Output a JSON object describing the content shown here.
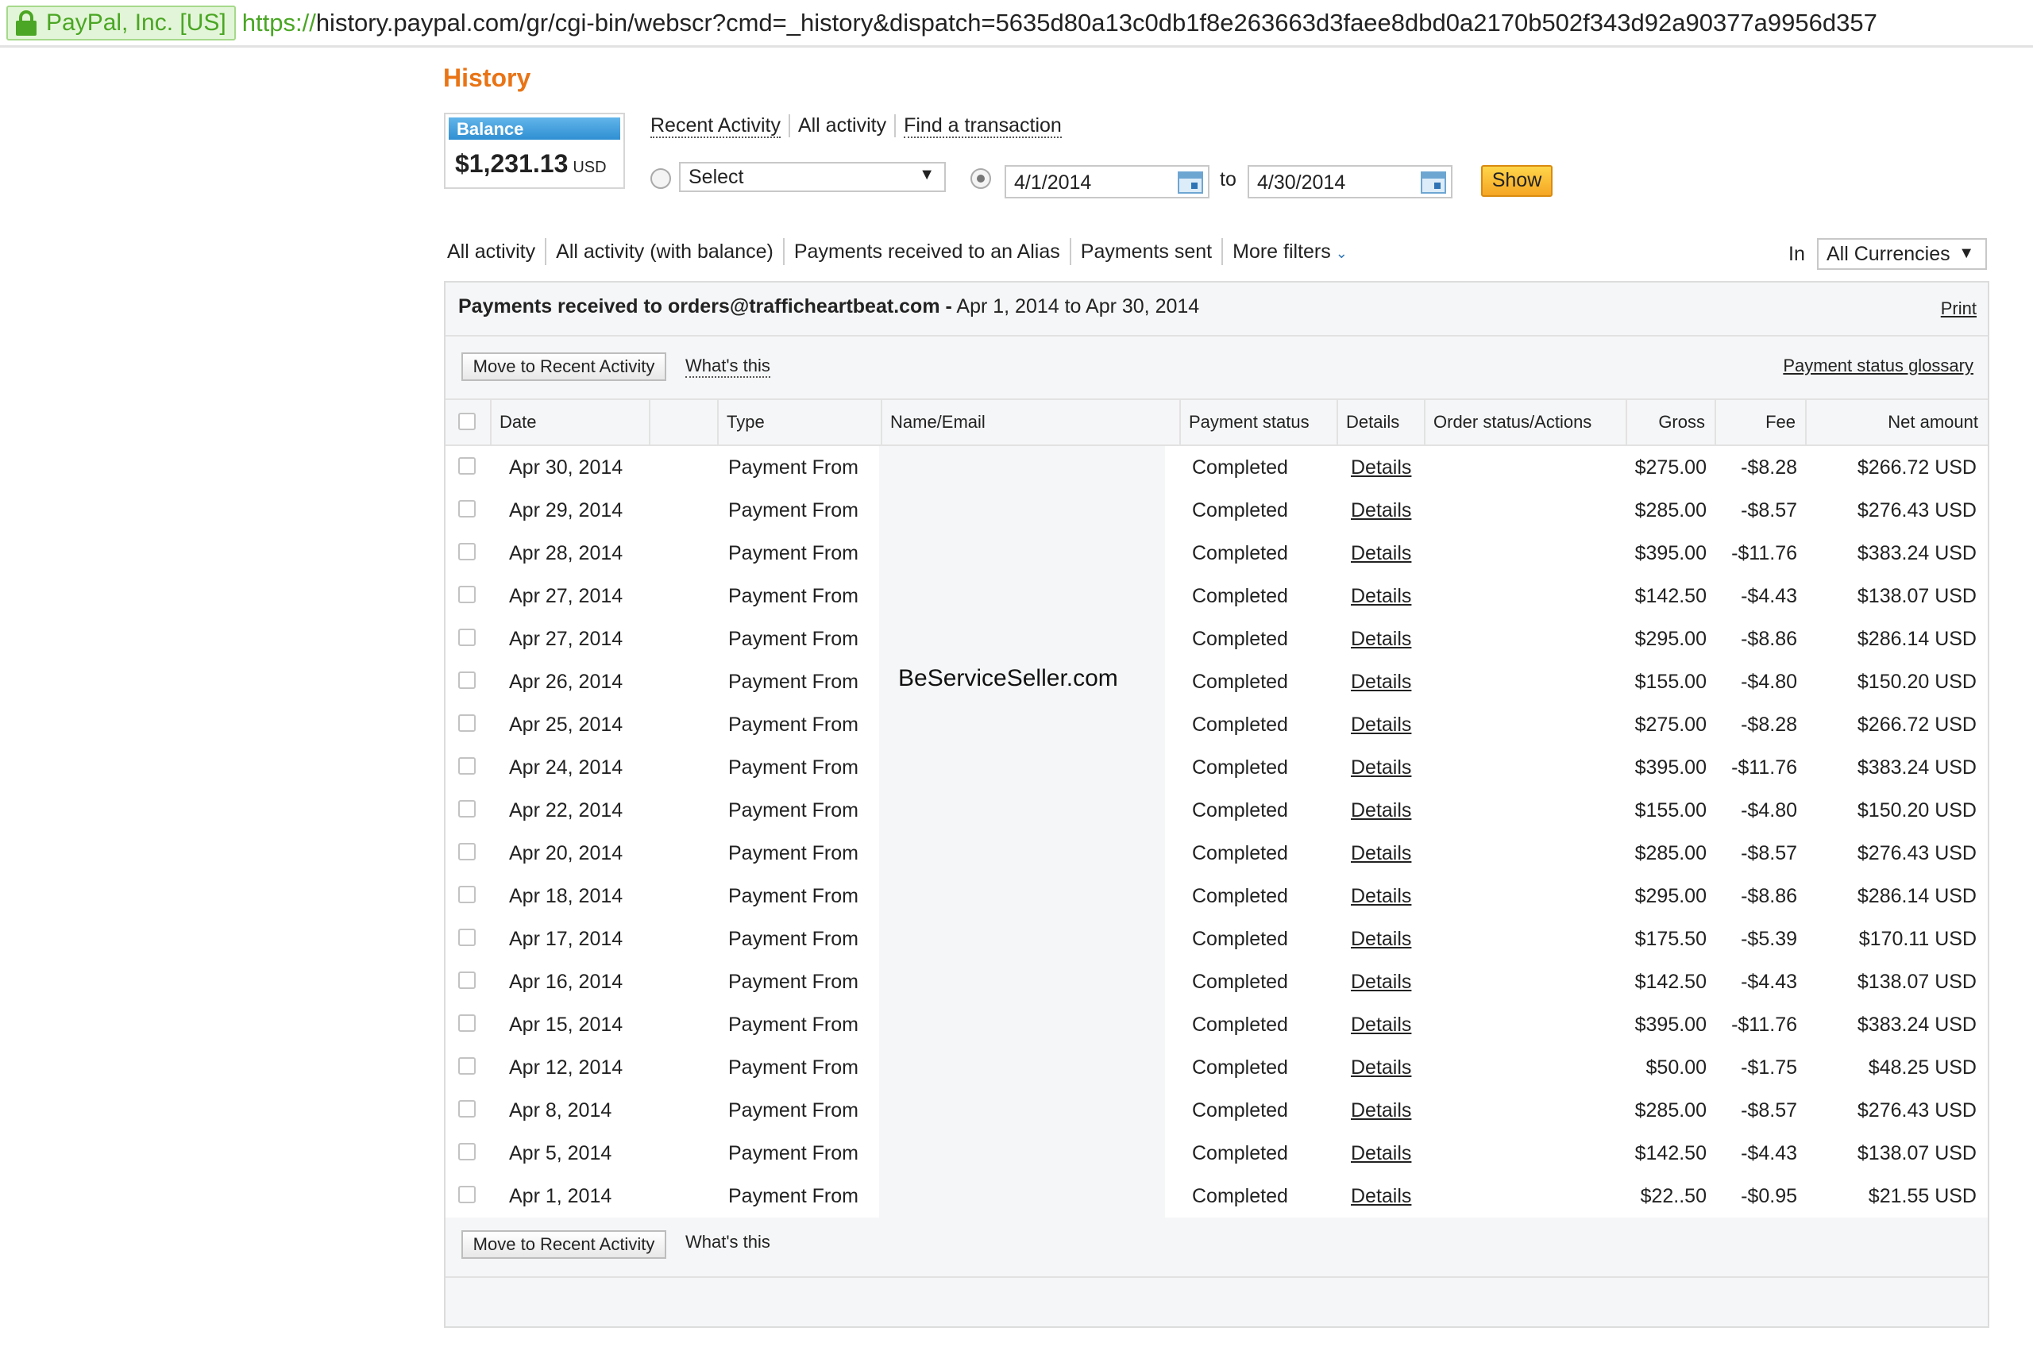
{
  "browser": {
    "ev_label": "PayPal, Inc. [US]",
    "url_scheme": "https://",
    "url_rest": "history.paypal.com/gr/cgi-bin/webscr?cmd=_history&dispatch=5635d80a13c0db1f8e263663d3faee8dbd0a2170b502f343d92a90377a9956d357"
  },
  "page": {
    "title": "History"
  },
  "balance": {
    "label": "Balance",
    "amount": "$1,231.13",
    "currency": "USD"
  },
  "top_tabs": [
    "Recent Activity",
    "All activity",
    "Find a transaction"
  ],
  "filters": {
    "select_label": "Select",
    "date_from": "4/1/2014",
    "to_label": "to",
    "date_to": "4/30/2014",
    "show_label": "Show"
  },
  "sub_tabs": [
    "All activity",
    "All activity (with balance)",
    "Payments received to an Alias",
    "Payments sent",
    "More filters"
  ],
  "currency": {
    "in_label": "In",
    "selected": "All Currencies"
  },
  "panel": {
    "title_bold": "Payments received to orders@trafficheartbeat.com -",
    "title_range": "Apr 1, 2014 to Apr 30, 2014",
    "print_label": "Print",
    "move_label": "Move to Recent Activity",
    "whats_this": "What's this",
    "glossary_label": "Payment status glossary"
  },
  "table": {
    "headers": [
      "Date",
      "Type",
      "Name/Email",
      "Payment status",
      "Details",
      "Order status/Actions",
      "Gross",
      "Fee",
      "Net amount"
    ],
    "rows": [
      {
        "date": "Apr 30, 2014",
        "type": "Payment From",
        "name": "",
        "status": "Completed",
        "details": "Details",
        "gross": "$275.00",
        "fee": "-$8.28",
        "net": "$266.72 USD"
      },
      {
        "date": "Apr 29, 2014",
        "type": "Payment From",
        "name": "",
        "status": "Completed",
        "details": "Details",
        "gross": "$285.00",
        "fee": "-$8.57",
        "net": "$276.43 USD"
      },
      {
        "date": "Apr 28, 2014",
        "type": "Payment From",
        "name": "",
        "status": "Completed",
        "details": "Details",
        "gross": "$395.00",
        "fee": "-$11.76",
        "net": "$383.24 USD"
      },
      {
        "date": "Apr 27, 2014",
        "type": "Payment From",
        "name": "",
        "status": "Completed",
        "details": "Details",
        "gross": "$142.50",
        "fee": "-$4.43",
        "net": "$138.07 USD"
      },
      {
        "date": "Apr 27, 2014",
        "type": "Payment From",
        "name": "",
        "status": "Completed",
        "details": "Details",
        "gross": "$295.00",
        "fee": "-$8.86",
        "net": "$286.14 USD"
      },
      {
        "date": "Apr 26, 2014",
        "type": "Payment From",
        "name": "",
        "status": "Completed",
        "details": "Details",
        "gross": "$155.00",
        "fee": "-$4.80",
        "net": "$150.20 USD"
      },
      {
        "date": "Apr 25, 2014",
        "type": "Payment From",
        "name": "",
        "status": "Completed",
        "details": "Details",
        "gross": "$275.00",
        "fee": "-$8.28",
        "net": "$266.72 USD"
      },
      {
        "date": "Apr 24, 2014",
        "type": "Payment From",
        "name": "",
        "status": "Completed",
        "details": "Details",
        "gross": "$395.00",
        "fee": "-$11.76",
        "net": "$383.24 USD"
      },
      {
        "date": "Apr 22, 2014",
        "type": "Payment From",
        "name": "",
        "status": "Completed",
        "details": "Details",
        "gross": "$155.00",
        "fee": "-$4.80",
        "net": "$150.20 USD"
      },
      {
        "date": "Apr 20, 2014",
        "type": "Payment From",
        "name": "",
        "status": "Completed",
        "details": "Details",
        "gross": "$285.00",
        "fee": "-$8.57",
        "net": "$276.43 USD"
      },
      {
        "date": "Apr 18, 2014",
        "type": "Payment From",
        "name": "",
        "status": "Completed",
        "details": "Details",
        "gross": "$295.00",
        "fee": "-$8.86",
        "net": "$286.14 USD"
      },
      {
        "date": "Apr 17, 2014",
        "type": "Payment From",
        "name": "",
        "status": "Completed",
        "details": "Details",
        "gross": "$175.50",
        "fee": "-$5.39",
        "net": "$170.11 USD"
      },
      {
        "date": "Apr 16, 2014",
        "type": "Payment From",
        "name": "",
        "status": "Completed",
        "details": "Details",
        "gross": "$142.50",
        "fee": "-$4.43",
        "net": "$138.07 USD"
      },
      {
        "date": "Apr 15, 2014",
        "type": "Payment From",
        "name": "",
        "status": "Completed",
        "details": "Details",
        "gross": "$395.00",
        "fee": "-$11.76",
        "net": "$383.24 USD"
      },
      {
        "date": "Apr 12, 2014",
        "type": "Payment From",
        "name": "",
        "status": "Completed",
        "details": "Details",
        "gross": "$50.00",
        "fee": "-$1.75",
        "net": "$48.25 USD"
      },
      {
        "date": "Apr 8, 2014",
        "type": "Payment From",
        "name": "",
        "status": "Completed",
        "details": "Details",
        "gross": "$285.00",
        "fee": "-$8.57",
        "net": "$276.43 USD"
      },
      {
        "date": "Apr 5, 2014",
        "type": "Payment From",
        "name": "",
        "status": "Completed",
        "details": "Details",
        "gross": "$142.50",
        "fee": "-$4.43",
        "net": "$138.07 USD"
      },
      {
        "date": "Apr 1, 2014",
        "type": "Payment From",
        "name": "",
        "status": "Completed",
        "details": "Details",
        "gross": "$22..50",
        "fee": "-$0.95",
        "net": "$21.55 USD"
      }
    ]
  },
  "watermark": "BeServiceSeller.com",
  "colors": {
    "title_orange": "#e97416",
    "ev_green": "#4aa624",
    "balance_blue": "#2f8fd2",
    "button_yellow": "#f5a623"
  },
  "icons": [
    "lock-icon",
    "calendar-icon",
    "chevron-down-icon",
    "dropdown-arrow-icon"
  ]
}
